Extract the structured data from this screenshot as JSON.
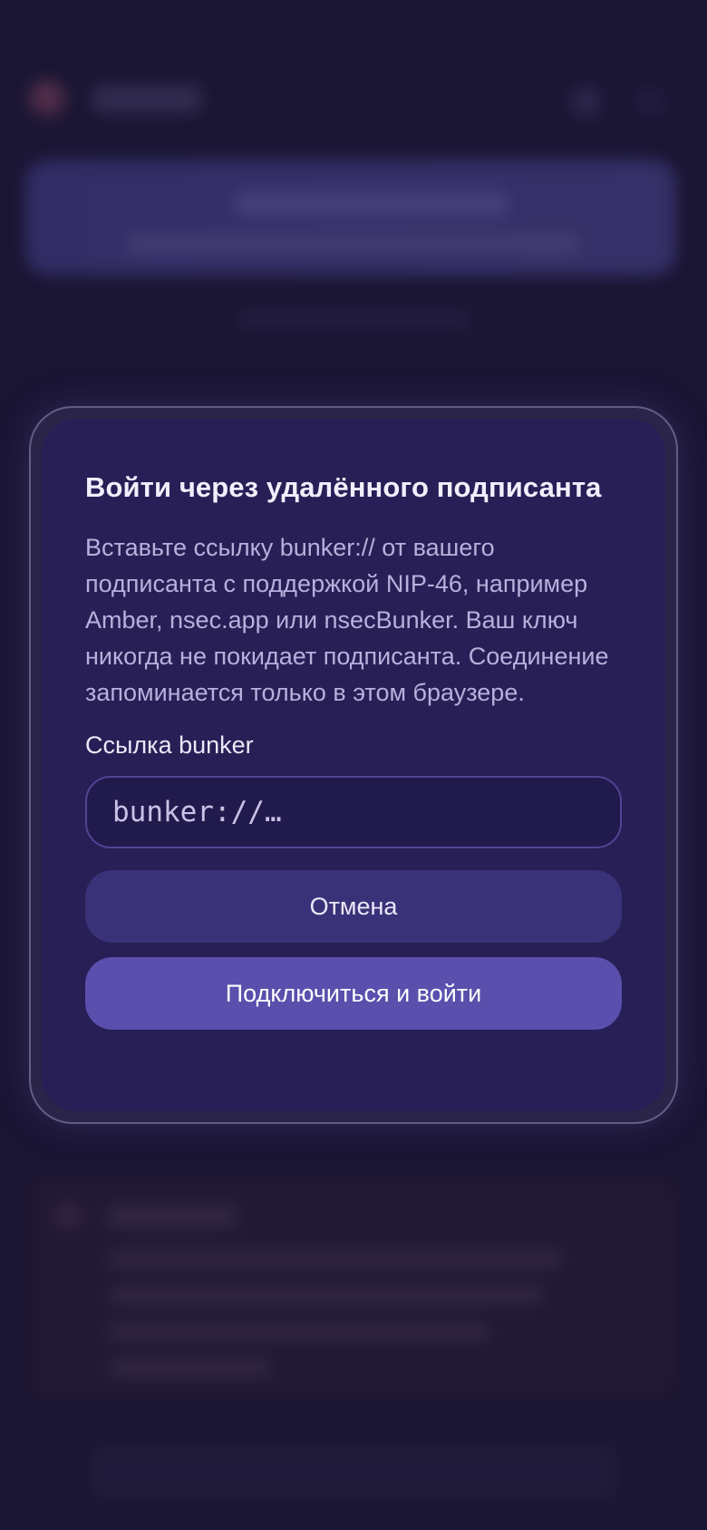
{
  "modal": {
    "title": "Войти через удалённого подписанта",
    "description": "Вставьте ссылку bunker:// от вашего подписанта с поддержкой NIP-46, например Amber, nsec.app или nsecBunker. Ваш ключ никогда не покидает подписанта. Соединение запоминается только в этом браузере.",
    "field_label": "Ссылка bunker",
    "input": {
      "value": "",
      "placeholder": "bunker://…"
    },
    "cancel_label": "Отмена",
    "connect_label": "Подключиться и войти"
  },
  "colors": {
    "modal_background": "#271f55",
    "primary_button": "#5a4fad",
    "secondary_button": "#3a3278",
    "page_background": "#1d1939"
  },
  "icons": [
    "app-logo-icon",
    "account-icon",
    "menu-icon"
  ]
}
